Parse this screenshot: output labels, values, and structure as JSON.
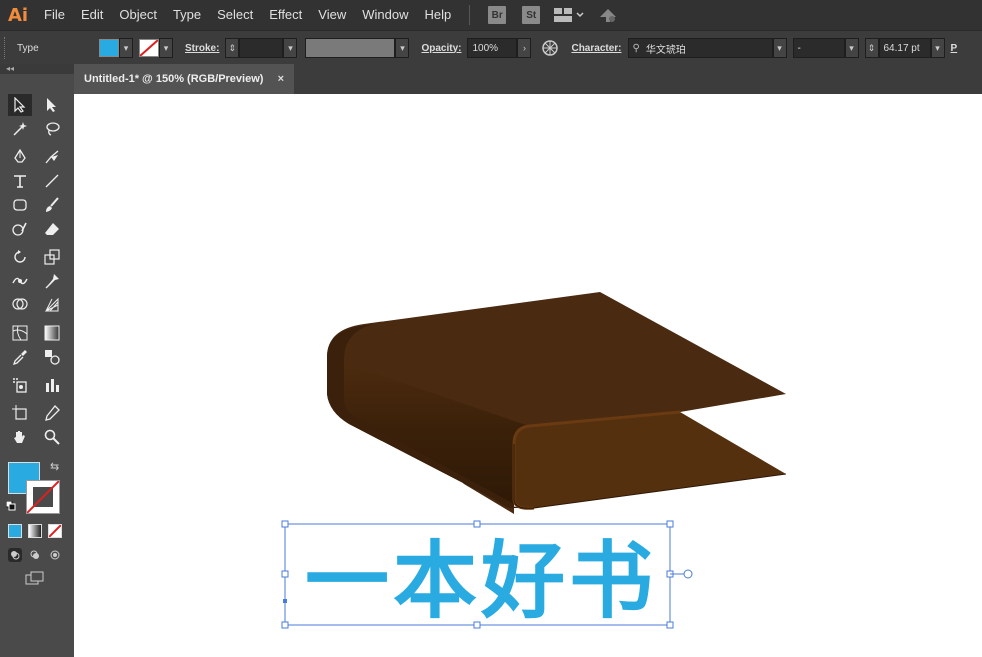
{
  "app": {
    "logo": "Ai"
  },
  "menu": {
    "items": [
      "File",
      "Edit",
      "Object",
      "Type",
      "Select",
      "Effect",
      "View",
      "Window",
      "Help"
    ],
    "bridge_label": "Br",
    "stock_label": "St",
    "workspace_icon": "workspace-grid-icon",
    "sync_icon": "gpu-sync-icon"
  },
  "control_bar": {
    "selection_type": "Type",
    "fill_color": "#29abe2",
    "stroke_color": "none",
    "stroke_label": "Stroke:",
    "stroke_value": "",
    "opacity_label": "Opacity:",
    "opacity_value": "100%",
    "character_label": "Character:",
    "font_family": "华文琥珀",
    "font_style": "-",
    "font_size": "64.17 pt",
    "overflow_label": "P"
  },
  "document": {
    "tab_title": "Untitled-1* @ 150% (RGB/Preview)",
    "tab_close": "×"
  },
  "toolbar": {
    "fill_color": "#29abe2",
    "stroke_color": "none"
  },
  "artwork": {
    "text": "一本好书",
    "text_color": "#29abe2",
    "book_colors": {
      "top": "#4a2a10",
      "front": "#3a200c",
      "inner": "#55300f"
    }
  }
}
